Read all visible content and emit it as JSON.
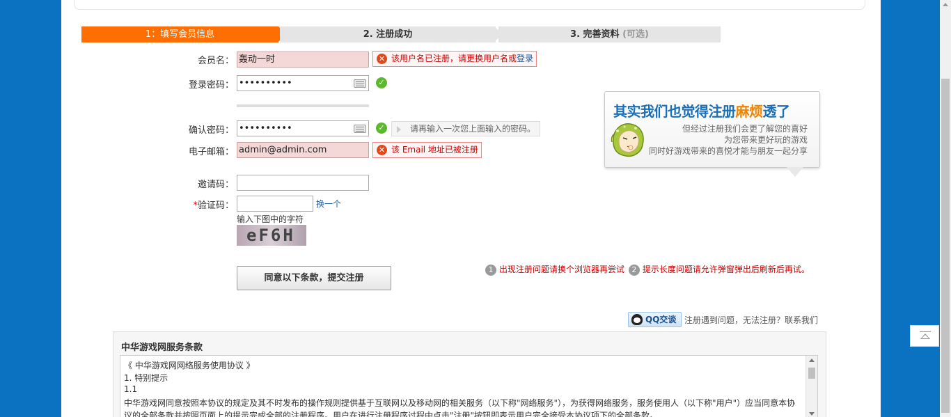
{
  "steps": {
    "step1": "1：填写会员信息",
    "step2": "2. 注册成功",
    "step3": "3. 完善资料",
    "step3_optional": "(可选)"
  },
  "form": {
    "username_label": "会员名：",
    "username_value": "轰动一时",
    "username_error": "该用户名已注册，请更换用户名或",
    "username_error_link": "登录",
    "password_label": "登录密码：",
    "password_value": "••••••••••",
    "confirm_label": "确认密码：",
    "confirm_value": "••••••••••",
    "confirm_hint": "请再输入一次您上面输入的密码。",
    "email_label": "电子邮箱：",
    "email_value": "admin@admin.com",
    "email_error": "该 Email 地址已被注册",
    "invite_label": "邀请码：",
    "invite_value": "",
    "captcha_required_mark": "*",
    "captcha_label": "验证码：",
    "captcha_value": "",
    "captcha_refresh": "换一个",
    "captcha_prompt": "输入下图中的字符",
    "captcha_image_text": "eF6H",
    "submit_label": "同意以下条款，提交注册"
  },
  "tips": {
    "tip1_num": "1",
    "tip1": "出现注册问题请换个浏览器再尝试",
    "tip2_num": "2",
    "tip2": "提示长度问题请允许弹窗弹出后刷新后再试。"
  },
  "bubble": {
    "title_a": "其实我们也觉得注册",
    "title_hl": "麻烦",
    "title_b": "透了",
    "line1": "但经过注册我们会更了解您的喜好",
    "line2": "为您带来更好玩的游戏",
    "line3": "同时好游戏带来的喜悦才能与朋友一起分享"
  },
  "support": {
    "qq_label": "QQ交谈",
    "text": "注册遇到问题，无法注册？联系我们"
  },
  "terms": {
    "title": "中华游戏网服务条款",
    "lines": [
      "《 中华游戏网网络服务使用协议 》",
      "1. 特别提示",
      "1.1",
      "中华游戏网同意按照本协议的规定及其不时发布的操作规则提供基于互联网以及移动网的相关服务（以下称\"网络服务\"），为获得网络服务，服务使用人（以下称\"用户\"）应当同意本协",
      "议的全部条款并按照页面上的提示完成全部的注册程序。用户在进行注册程序过程中点击\"注册\"按钮即表示用户完全接受本协议项下的全部条款。"
    ]
  },
  "colors": {
    "background": "#0a72c0",
    "active_step": "#ff6e00",
    "error": "#cc0000",
    "ok": "#5cb82c",
    "brand_blue": "#1a6fb6"
  }
}
